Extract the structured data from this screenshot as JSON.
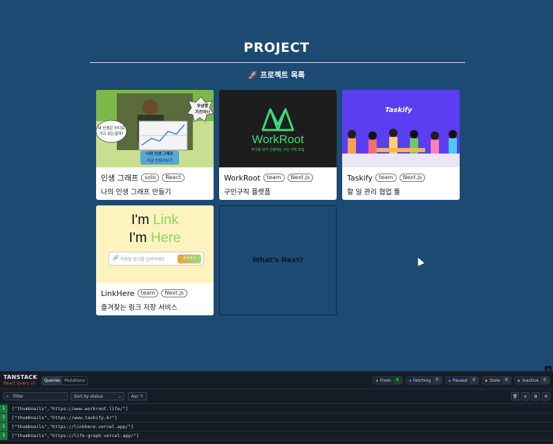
{
  "page": {
    "title": "PROJECT",
    "subtitle": "🚀 프로젝트 목록",
    "colors": {
      "background": "#1c4a73",
      "card": "#ffffff"
    }
  },
  "projects": [
    {
      "name": "인생 그래프",
      "tags": [
        "solo",
        "React"
      ],
      "description": "나의 인생 그래프 만들기",
      "thumb": {
        "bubble_top": "우상향\n가즈아!!",
        "bubble_left": "내 인생은 어디로\n가고 있는걸까?",
        "caption1": "나의 인생 그래프",
        "caption2": "지금 만들어보기"
      }
    },
    {
      "name": "WorkRoot",
      "tags": [
        "team",
        "Next.js"
      ],
      "description": "구인구직 플랫폼",
      "thumb": {
        "logo_text": "WorkRoot",
        "tagline": "무기를 내가 선정하는 구인 구직 모집"
      }
    },
    {
      "name": "Taskify",
      "tags": [
        "team",
        "Next.js"
      ],
      "description": "할 일 관리 협업 툴",
      "thumb": {
        "logo_text": "Taskify"
      }
    },
    {
      "name": "LinkHere",
      "tags": [
        "team",
        "Next.js"
      ],
      "description": "즐겨찾는 링크 저장 서비스",
      "thumb": {
        "line1_a": "I'm ",
        "line1_b": "Link",
        "line2_a": "I'm ",
        "line2_b": "Here",
        "input_placeholder": "저장할 링크를 입력하세요",
        "button": "추가하기"
      }
    }
  ],
  "next_card": {
    "label": "What's Next?"
  },
  "devtools": {
    "logo_title": "TANSTACK",
    "logo_sub": "React Query v5",
    "tabs": [
      "Queries",
      "Mutations"
    ],
    "badges": [
      {
        "label": "Fresh",
        "count": "4",
        "color": "#22c55e"
      },
      {
        "label": "Fetching",
        "count": "0",
        "color": "#3b82f6"
      },
      {
        "label": "Paused",
        "count": "0",
        "color": "#8b5cf6"
      },
      {
        "label": "Stale",
        "count": "0",
        "color": "#f59e0b"
      },
      {
        "label": "Inactive",
        "count": "0",
        "color": "#9ca3af"
      }
    ],
    "filter_placeholder": "Filter",
    "sort_label": "Sort by status",
    "order_label": "Asc ↑",
    "queries": [
      {
        "count": "1",
        "key": "[\"thumbnails\",\"https://www.workroot.life/\"]"
      },
      {
        "count": "1",
        "key": "[\"thumbnails\",\"https://www.taskify.kr\"]"
      },
      {
        "count": "1",
        "key": "[\"thumbnails\",\"https://linkhere.vercel.app/\"]"
      },
      {
        "count": "1",
        "key": "[\"thumbnails\",\"https://life-graph.vercel.app/\"]"
      }
    ]
  }
}
